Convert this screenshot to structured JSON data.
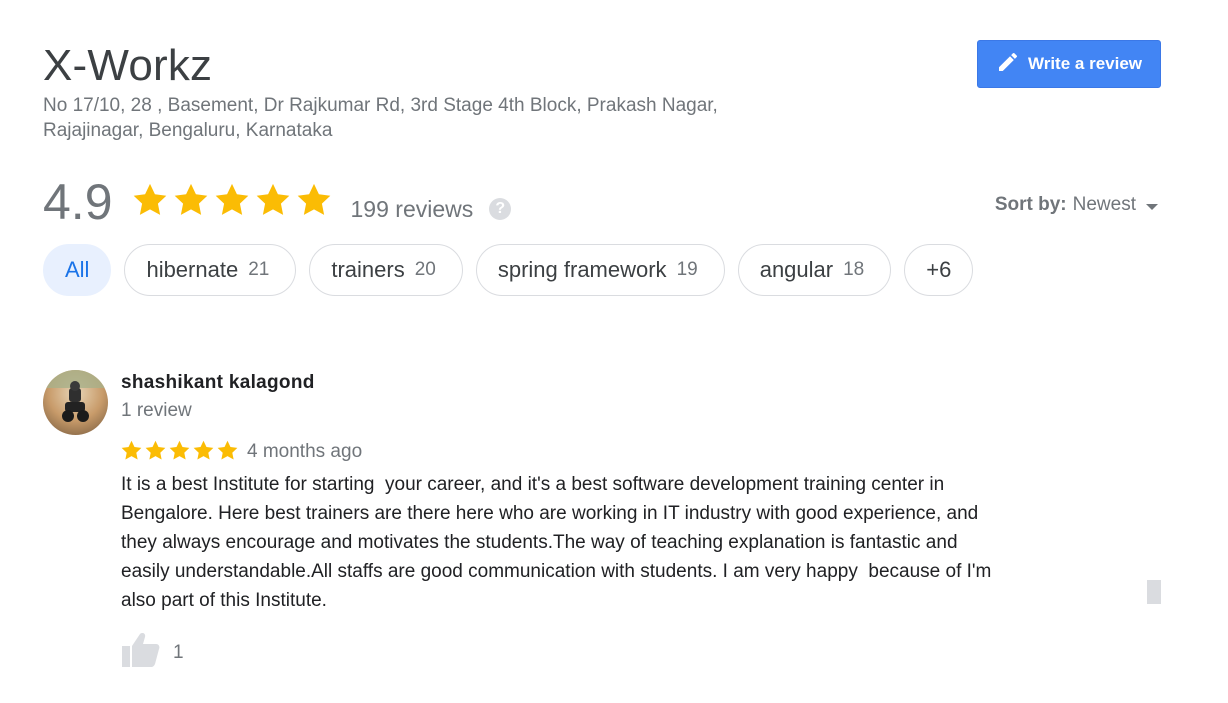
{
  "place": {
    "name": "X-Workz",
    "address_line1": "No 17/10, 28 , Basement, Dr Rajkumar Rd, 3rd Stage 4th Block, Prakash Nagar,",
    "address_line2": "Rajajinagar, Bengaluru, Karnataka"
  },
  "write_review": {
    "label": "Write a review",
    "icon": "pencil-icon"
  },
  "rating": {
    "value": "4.9",
    "stars": 5,
    "review_count": "199 reviews",
    "help_icon": "?"
  },
  "sort": {
    "label": "Sort by:",
    "value": "Newest"
  },
  "chips": [
    {
      "label": "All",
      "count": "",
      "active": true
    },
    {
      "label": "hibernate",
      "count": "21"
    },
    {
      "label": "trainers",
      "count": "20"
    },
    {
      "label": "spring framework",
      "count": "19"
    },
    {
      "label": "angular",
      "count": "18"
    },
    {
      "label": "+6",
      "count": ""
    }
  ],
  "review": {
    "author": "shashikant kalagond",
    "author_reviews": "1 review",
    "stars": 5,
    "time": "4 months ago",
    "text": "It is a best Institute for starting  your career, and it's a best software development training center in\nBengalore. Here best trainers are there here who are working in IT industry with good experience, and\nthey always encourage and motivates the students.The way of teaching explanation is fantastic and\neasily understandable.All staffs are good communication with students. I am very happy  because of I'm\nalso part of this Institute.",
    "likes": "1"
  },
  "colors": {
    "star": "#fbbc04",
    "button": "#4285f4",
    "chip_active_bg": "#e8f0fe",
    "chip_active_text": "#1a73e8"
  }
}
